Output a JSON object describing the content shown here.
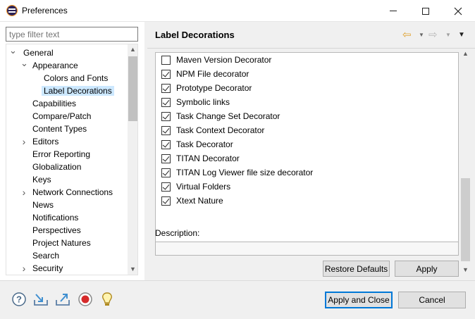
{
  "window": {
    "title": "Preferences",
    "icon": "eclipse-icon",
    "controls": [
      "minimize-icon",
      "maximize-icon",
      "close-icon"
    ]
  },
  "filter": {
    "placeholder": "type filter text"
  },
  "tree": {
    "selected": "Label Decorations",
    "items": [
      {
        "label": "General",
        "level": 0,
        "expander": "expanded"
      },
      {
        "label": "Appearance",
        "level": 1,
        "expander": "expanded"
      },
      {
        "label": "Colors and Fonts",
        "level": 2,
        "expander": "none"
      },
      {
        "label": "Label Decorations",
        "level": 2,
        "expander": "none"
      },
      {
        "label": "Capabilities",
        "level": 1,
        "expander": "none"
      },
      {
        "label": "Compare/Patch",
        "level": 1,
        "expander": "none"
      },
      {
        "label": "Content Types",
        "level": 1,
        "expander": "none"
      },
      {
        "label": "Editors",
        "level": 1,
        "expander": "collapsed"
      },
      {
        "label": "Error Reporting",
        "level": 1,
        "expander": "none"
      },
      {
        "label": "Globalization",
        "level": 1,
        "expander": "none"
      },
      {
        "label": "Keys",
        "level": 1,
        "expander": "none"
      },
      {
        "label": "Network Connections",
        "level": 1,
        "expander": "collapsed"
      },
      {
        "label": "News",
        "level": 1,
        "expander": "none"
      },
      {
        "label": "Notifications",
        "level": 1,
        "expander": "none"
      },
      {
        "label": "Perspectives",
        "level": 1,
        "expander": "none"
      },
      {
        "label": "Project Natures",
        "level": 1,
        "expander": "none"
      },
      {
        "label": "Search",
        "level": 1,
        "expander": "none"
      },
      {
        "label": "Security",
        "level": 1,
        "expander": "collapsed"
      }
    ]
  },
  "page": {
    "title": "Label Decorations",
    "nav_icons": [
      "back-arrow-icon",
      "back-dropdown-icon",
      "forward-arrow-icon",
      "forward-dropdown-icon",
      "view-menu-icon"
    ],
    "decorators": [
      {
        "label": "Maven Version Decorator",
        "checked": false
      },
      {
        "label": "NPM File decorator",
        "checked": true
      },
      {
        "label": "Prototype Decorator",
        "checked": true
      },
      {
        "label": "Symbolic links",
        "checked": true
      },
      {
        "label": "Task Change Set Decorator",
        "checked": true
      },
      {
        "label": "Task Context Decorator",
        "checked": true
      },
      {
        "label": "Task Decorator",
        "checked": true
      },
      {
        "label": "TITAN Decorator",
        "checked": true
      },
      {
        "label": "TITAN Log Viewer file size decorator",
        "checked": true
      },
      {
        "label": "Virtual Folders",
        "checked": true
      },
      {
        "label": "Xtext Nature",
        "checked": true
      }
    ],
    "description_label": "Description:",
    "description_value": "",
    "restore_defaults_label": "Restore Defaults",
    "apply_label": "Apply"
  },
  "footer": {
    "icons": [
      "help-icon",
      "import-icon",
      "export-icon",
      "record-icon",
      "tip-bulb-icon"
    ],
    "apply_close_label": "Apply and Close",
    "cancel_label": "Cancel"
  }
}
